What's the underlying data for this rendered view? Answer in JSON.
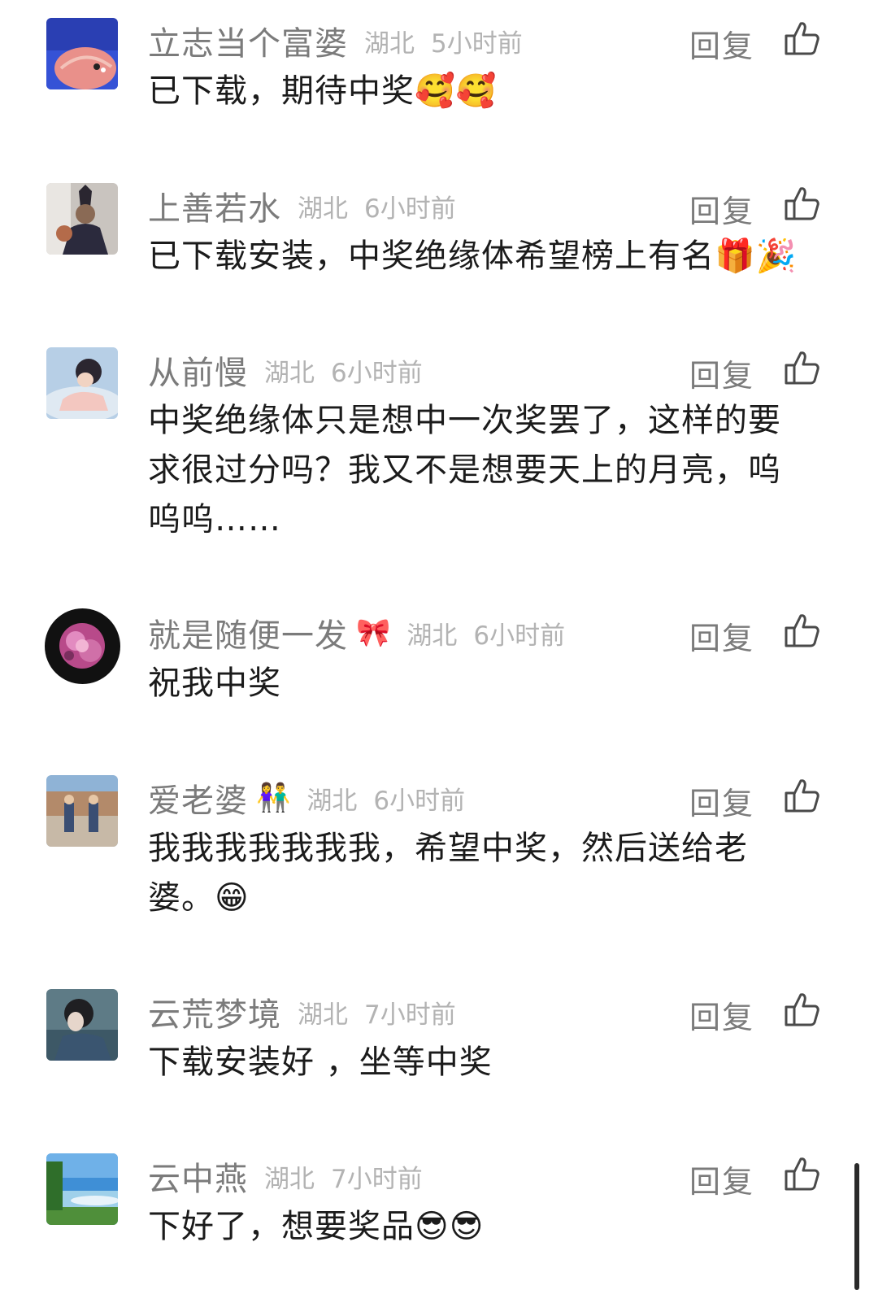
{
  "comments": [
    {
      "username": "立志当个富婆",
      "user_emoji": "",
      "location": "湖北",
      "time": "5小时前",
      "reply_label": "回复",
      "content": "已下载，期待中奖🥰🥰"
    },
    {
      "username": "上善若水",
      "user_emoji": "",
      "location": "湖北",
      "time": "6小时前",
      "reply_label": "回复",
      "content": "已下载安装，中奖绝缘体希望榜上有名🎁🎉"
    },
    {
      "username": "从前慢",
      "user_emoji": "",
      "location": "湖北",
      "time": "6小时前",
      "reply_label": "回复",
      "content": "中奖绝缘体只是想中一次奖罢了，这样的要求很过分吗？我又不是想要天上的月亮，呜呜呜……"
    },
    {
      "username": "就是随便一发",
      "user_emoji": "🎀",
      "location": "湖北",
      "time": "6小时前",
      "reply_label": "回复",
      "content": "祝我中奖"
    },
    {
      "username": "爱老婆",
      "user_emoji": "👫",
      "location": "湖北",
      "time": "6小时前",
      "reply_label": "回复",
      "content": "我我我我我我我，希望中奖，然后送给老婆。😁"
    },
    {
      "username": "云荒梦境",
      "user_emoji": "",
      "location": "湖北",
      "time": "7小时前",
      "reply_label": "回复",
      "content": "下载安装好 ，坐等中奖"
    },
    {
      "username": "云中燕",
      "user_emoji": "",
      "location": "湖北",
      "time": "7小时前",
      "reply_label": "回复",
      "content": "下好了，想要奖品😎😎"
    }
  ],
  "icons": {
    "like": "thumbs-up-outline-icon"
  },
  "colors": {
    "username": "#7b7b7b",
    "meta": "#b3b3b3",
    "content": "#1b1b1b"
  }
}
